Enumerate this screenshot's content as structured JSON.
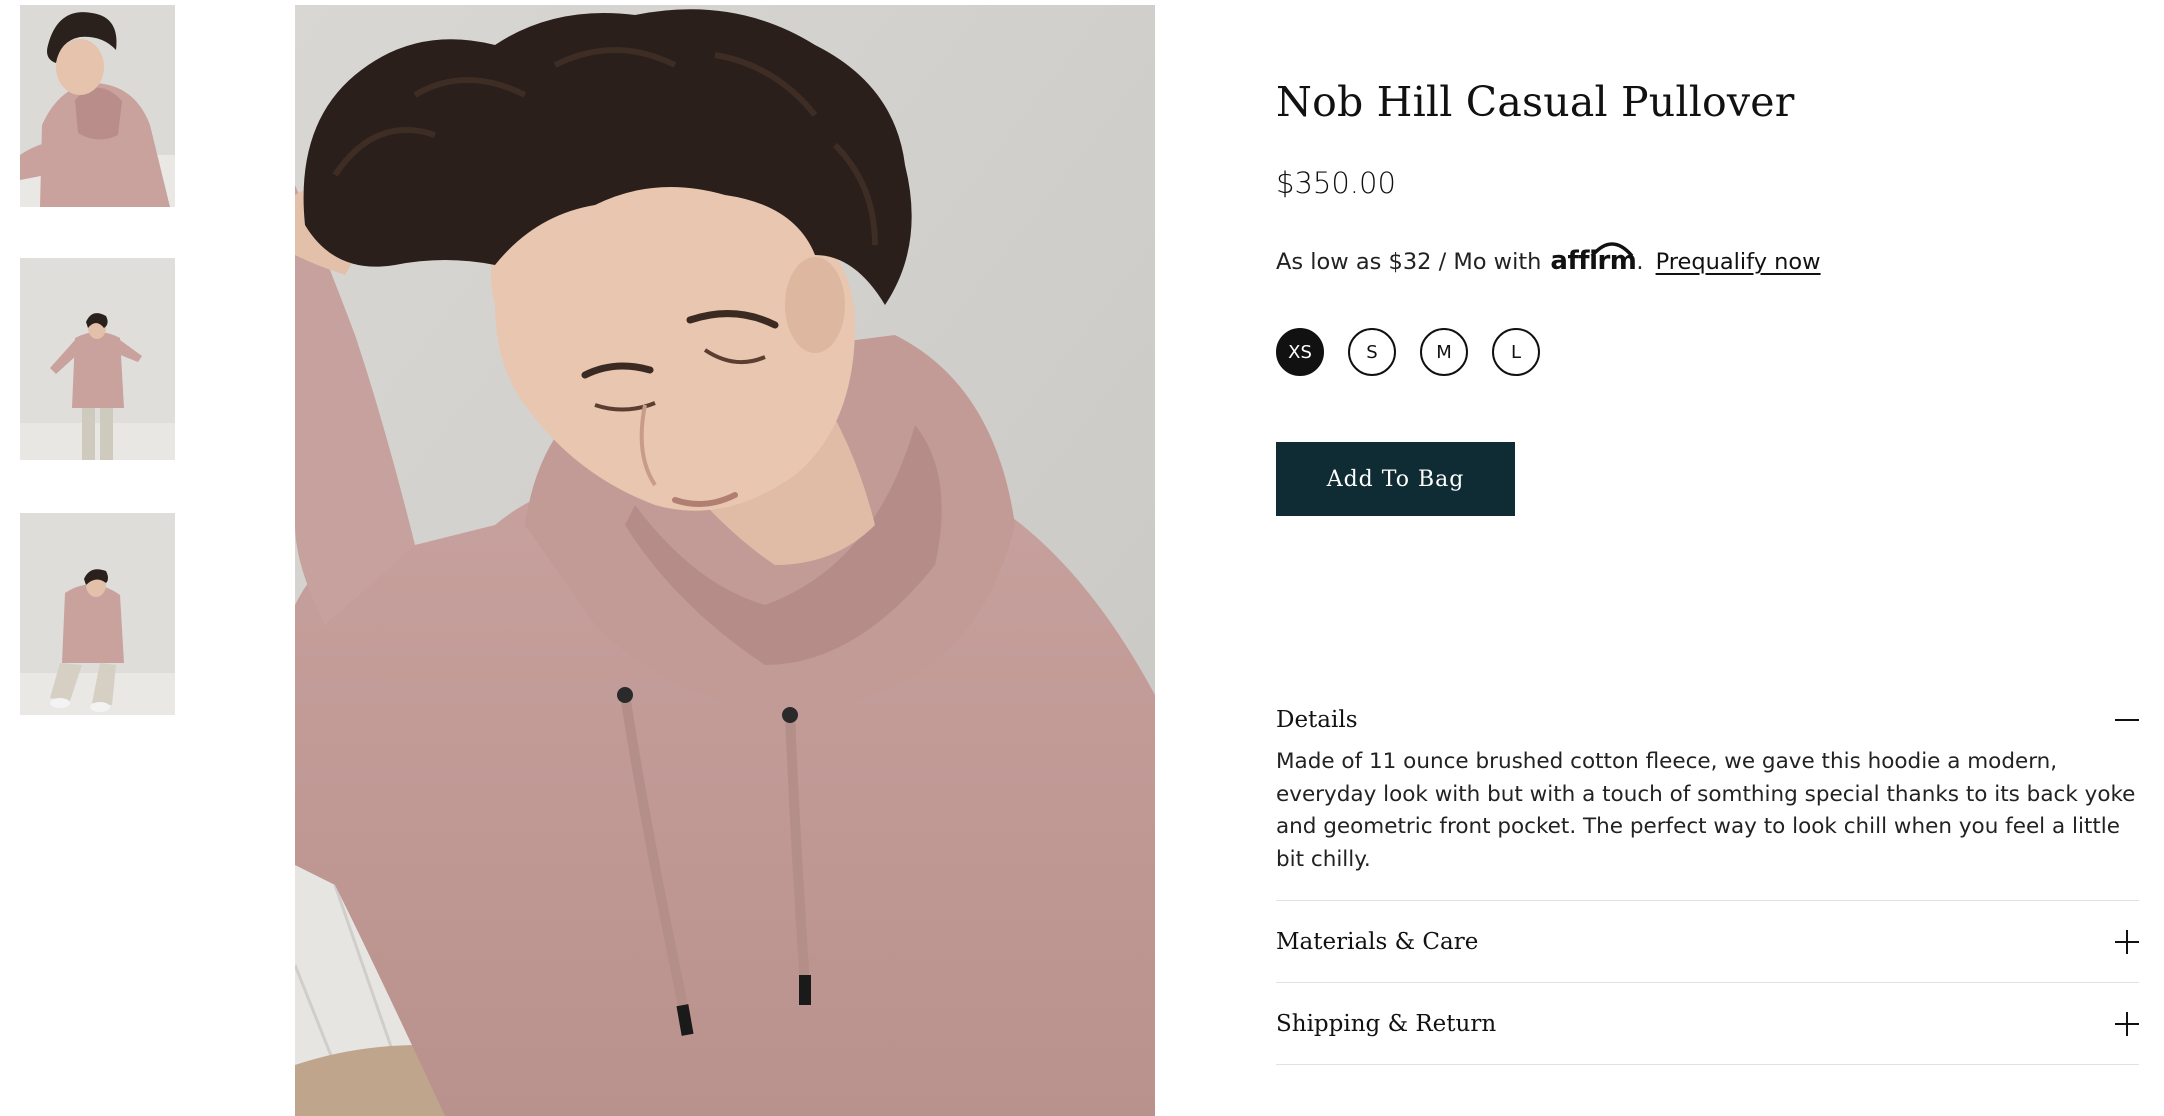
{
  "gallery": {
    "thumbnails": [
      {
        "alt": "thumbnail-1"
      },
      {
        "alt": "thumbnail-2"
      },
      {
        "alt": "thumbnail-3"
      }
    ]
  },
  "product": {
    "title": "Nob Hill Casual Pullover",
    "price": "$350.00",
    "financing": {
      "prefix": "As low as $32 / Mo with",
      "provider": "affirm",
      "suffix": ".",
      "link_label": "Prequalify now"
    },
    "sizes": [
      {
        "label": "XS",
        "selected": true
      },
      {
        "label": "S",
        "selected": false
      },
      {
        "label": "M",
        "selected": false
      },
      {
        "label": "L",
        "selected": false
      }
    ],
    "add_to_bag_label": "Add To Bag"
  },
  "accordion": {
    "details": {
      "title": "Details",
      "body": "Made of 11 ounce brushed cotton fleece, we gave this hoodie a modern, everyday look with but with a touch of somthing special thanks to its back yoke and geometric front pocket. The perfect way to look chill when you feel a little bit chilly.",
      "expanded": true
    },
    "materials": {
      "title": "Materials & Care",
      "expanded": false
    },
    "shipping": {
      "title": "Shipping & Return",
      "expanded": false
    }
  },
  "colors": {
    "button_bg": "#0f2b34",
    "hoodie": "#c9a3a0",
    "wall": "#e4e2df",
    "hair": "#2a1f1a"
  }
}
